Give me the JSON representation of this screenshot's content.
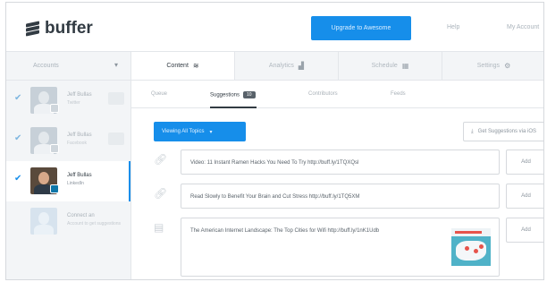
{
  "header": {
    "logo_text": "buffer",
    "upgrade_label": "Upgrade to Awesome",
    "help_label": "Help",
    "account_label": "My Account"
  },
  "sidebar": {
    "accounts_label": "Accounts",
    "profiles": [
      {
        "name": "Jeff Bullas",
        "sub": "Twitter",
        "checked": true,
        "active": false
      },
      {
        "name": "Jeff Bullas",
        "sub": "Facebook",
        "checked": true,
        "active": false
      },
      {
        "name": "Jeff Bullas",
        "sub": "LinkedIn",
        "checked": true,
        "active": true
      },
      {
        "name": "Connect an",
        "sub": "Account to get suggestions",
        "checked": false,
        "active": false
      }
    ]
  },
  "main_tabs": [
    {
      "label": "Content",
      "icon": "layers-icon",
      "active": true
    },
    {
      "label": "Analytics",
      "icon": "bar-chart-icon",
      "active": false
    },
    {
      "label": "Schedule",
      "icon": "calendar-icon",
      "active": false
    },
    {
      "label": "Settings",
      "icon": "gear-icon",
      "active": false
    }
  ],
  "sub_tabs": {
    "queue": "Queue",
    "suggestions": "Suggestions",
    "suggestions_count": "10",
    "contributors": "Contributors",
    "feeds": "Feeds"
  },
  "filters": {
    "topics_label": "Viewing All Topics",
    "get_label": "Get Suggestions via iOS"
  },
  "suggestions": [
    {
      "icon": "link-icon",
      "text": "Video: 11 Instant Ramen Hacks You Need To Try http://buff.ly/1TQXQsl",
      "add_label": "Add"
    },
    {
      "icon": "link-icon",
      "text": "Read Slowly to Benefit Your Brain and Cut Stress http://buff.ly/1TQ5XM",
      "add_label": "Add"
    },
    {
      "icon": "image-icon",
      "text": "The American Internet Landscape: The Top Cities for Wifi http://buff.ly/1nK1Udb",
      "add_label": "Add"
    }
  ]
}
